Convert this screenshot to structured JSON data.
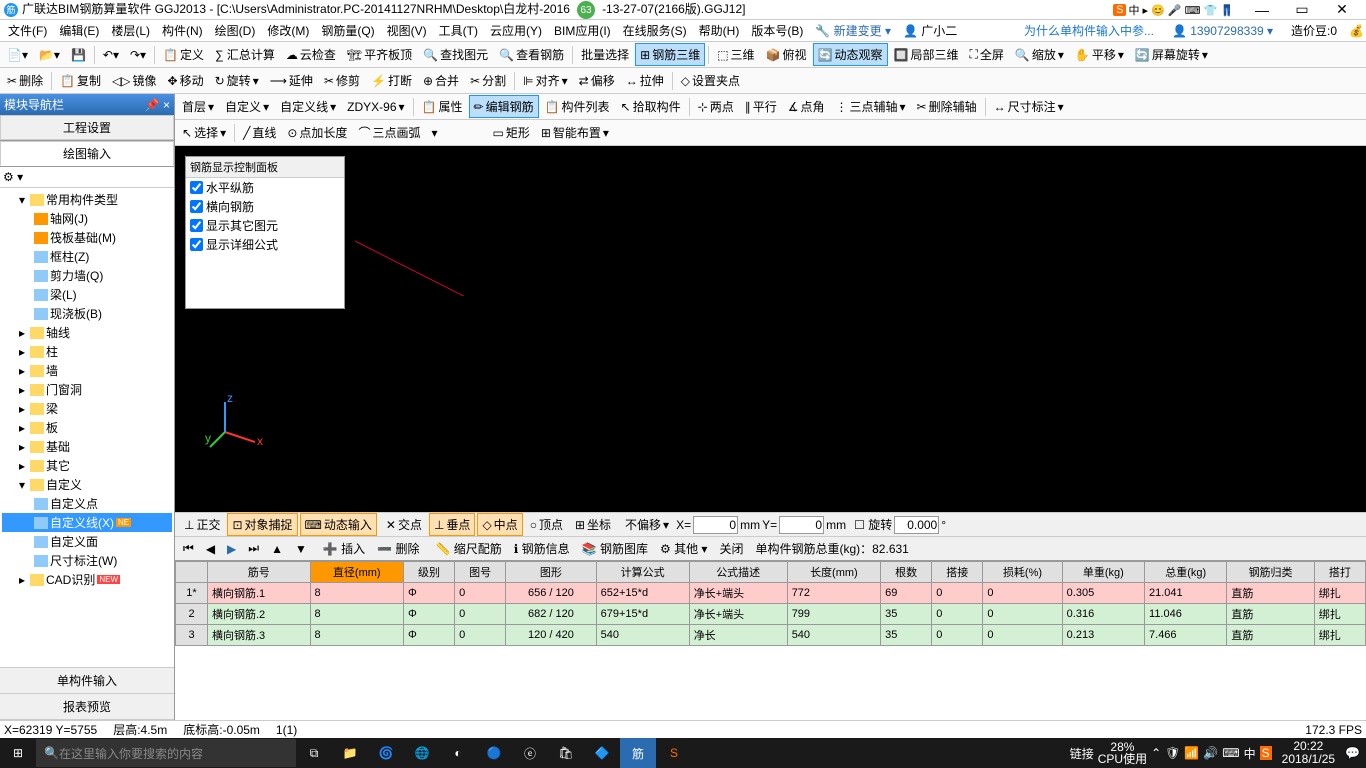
{
  "titlebar": {
    "app": "广联达BIM钢筋算量软件 GGJ2013 - [C:\\Users\\Administrator.PC-20141127NRHM\\Desktop\\白龙村-2016",
    "suffix": "-13-27-07(2166版).GGJ12]",
    "badge": "63",
    "ime_icon": "S",
    "ime": "中 ▸ 😊 🎤 ⌨ 👕 👖"
  },
  "menubar": {
    "items": [
      "文件(F)",
      "编辑(E)",
      "楼层(L)",
      "构件(N)",
      "绘图(D)",
      "修改(M)",
      "钢筋量(Q)",
      "视图(V)",
      "工具(T)",
      "云应用(Y)",
      "BIM应用(I)",
      "在线服务(S)",
      "帮助(H)",
      "版本号(B)"
    ],
    "newchange": "新建变更",
    "guangxiaoer": "广小二",
    "linktext": "为什么单构件输入中参...",
    "phone": "13907298339",
    "beans": "造价豆:0"
  },
  "toolbar1": {
    "define": "定义",
    "sumcalc": "∑ 汇总计算",
    "cloudcheck": "云检查",
    "flatroof": "平齐板顶",
    "findgraph": "查找图元",
    "viewrebar": "查看钢筋",
    "batchsel": "批量选择",
    "rebar3d": "钢筋三维",
    "threed": "三维",
    "bird": "俯视",
    "dynobs": "动态观察",
    "local3d": "局部三维",
    "fullscreen": "全屏",
    "zoom": "缩放",
    "pan": "平移",
    "screenrot": "屏幕旋转"
  },
  "toolbar2": {
    "delete": "删除",
    "copy": "复制",
    "mirror": "镜像",
    "move": "移动",
    "rotate": "旋转",
    "extend": "延伸",
    "trim": "修剪",
    "break": "打断",
    "merge": "合并",
    "split": "分割",
    "align": "对齐",
    "offset": "偏移",
    "stretch": "拉伸",
    "setpoint": "设置夹点"
  },
  "toolbar3": {
    "floor": "首层",
    "custom": "自定义",
    "customline": "自定义线",
    "zdyx": "ZDYX-96",
    "attr": "属性",
    "editrebar": "编辑钢筋",
    "complist": "构件列表",
    "pickcomp": "拾取构件",
    "twopt": "两点",
    "parallel": "平行",
    "ptangle": "点角",
    "threeaux": "三点辅轴",
    "delaux": "删除辅轴",
    "dimmark": "尺寸标注"
  },
  "toolbar4": {
    "select": "选择",
    "line": "直线",
    "ptlen": "点加长度",
    "threeparc": "三点画弧",
    "rect": "矩形",
    "smartlayout": "智能布置"
  },
  "sidebar": {
    "title": "模块导航栏",
    "tab_proj": "工程设置",
    "tab_draw": "绘图输入",
    "root": "常用构件类型",
    "items": [
      "轴网(J)",
      "筏板基础(M)",
      "框柱(Z)",
      "剪力墙(Q)",
      "梁(L)",
      "现浇板(B)"
    ],
    "cats": [
      "轴线",
      "柱",
      "墙",
      "门窗洞",
      "梁",
      "板",
      "基础",
      "其它"
    ],
    "custom": "自定义",
    "custitems": [
      "自定义点",
      "自定义线(X)",
      "自定义面",
      "尺寸标注(W)"
    ],
    "cad": "CAD识别",
    "footer1": "单构件输入",
    "footer2": "报表预览"
  },
  "rebarpanel": {
    "title": "钢筋显示控制面板",
    "opts": [
      "水平纵筋",
      "横向钢筋",
      "显示其它图元",
      "显示详细公式"
    ]
  },
  "snapbar": {
    "ortho": "正交",
    "objsnap": "对象捕捉",
    "dyninput": "动态输入",
    "intersect": "交点",
    "perp": "垂点",
    "mid": "中点",
    "vertex": "顶点",
    "coord": "坐标",
    "nooffset": "不偏移",
    "x": "X=",
    "y": "Y=",
    "mm": "mm",
    "rotate": "旋转",
    "xval": "0",
    "yval": "0",
    "rotval": "0.000"
  },
  "navbar": {
    "insert": "插入",
    "delete": "删除",
    "scalerebar": "缩尺配筋",
    "rebarinfo": "钢筋信息",
    "rebarlib": "钢筋图库",
    "other": "其他",
    "close": "关闭",
    "total": "单构件钢筋总重(kg)：82.631"
  },
  "table": {
    "headers": [
      "",
      "筋号",
      "直径(mm)",
      "级别",
      "图号",
      "图形",
      "计算公式",
      "公式描述",
      "长度(mm)",
      "根数",
      "搭接",
      "损耗(%)",
      "单重(kg)",
      "总重(kg)",
      "钢筋归类",
      "搭打"
    ],
    "rows": [
      {
        "n": "1*",
        "id": "横向钢筋.1",
        "dia": "8",
        "lvl": "Φ",
        "fig": "0",
        "shape": "656 / 120",
        "formula": "652+15*d",
        "desc": "净长+端头",
        "len": "772",
        "cnt": "69",
        "lap": "0",
        "loss": "0",
        "uw": "0.305",
        "tw": "21.041",
        "cls": "直筋",
        "tie": "绑扎"
      },
      {
        "n": "2",
        "id": "横向钢筋.2",
        "dia": "8",
        "lvl": "Φ",
        "fig": "0",
        "shape": "682 / 120",
        "formula": "679+15*d",
        "desc": "净长+端头",
        "len": "799",
        "cnt": "35",
        "lap": "0",
        "loss": "0",
        "uw": "0.316",
        "tw": "11.046",
        "cls": "直筋",
        "tie": "绑扎"
      },
      {
        "n": "3",
        "id": "横向钢筋.3",
        "dia": "8",
        "lvl": "Φ",
        "fig": "0",
        "shape": "120 / 420",
        "formula": "540",
        "desc": "净长",
        "len": "540",
        "cnt": "35",
        "lap": "0",
        "loss": "0",
        "uw": "0.213",
        "tw": "7.466",
        "cls": "直筋",
        "tie": "绑扎"
      }
    ]
  },
  "statusbar": {
    "xy": "X=62319 Y=5755",
    "floor": "层高:4.5m",
    "bottom": "底标高:-0.05m",
    "sel": "1(1)",
    "fps": "172.3 FPS"
  },
  "taskbar": {
    "search": "在这里输入你要搜索的内容",
    "conn": "链接",
    "cpu": "28%",
    "cpu2": "CPU使用",
    "time": "20:22",
    "date": "2018/1/25"
  }
}
